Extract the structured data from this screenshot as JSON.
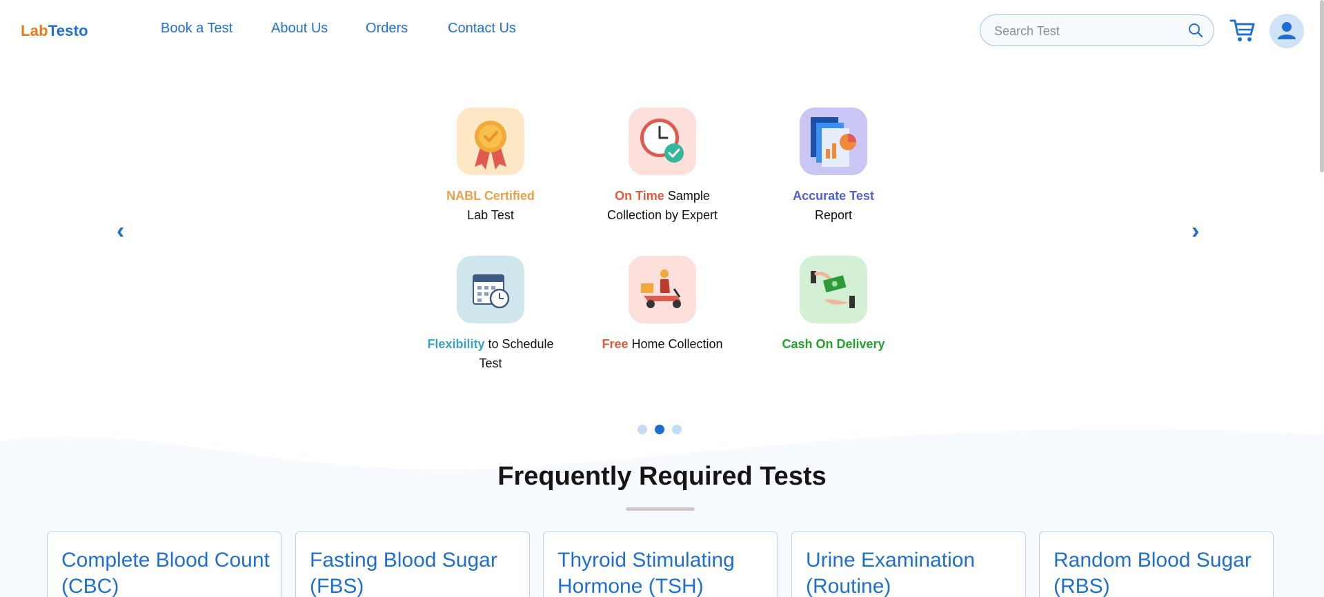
{
  "brand": {
    "part1": "Lab",
    "part2": "Testo",
    "color1": "#e8791c",
    "color2": "#1f6fd1"
  },
  "nav": [
    {
      "label": "Book a Test"
    },
    {
      "label": "About Us"
    },
    {
      "label": "Orders"
    },
    {
      "label": "Contact Us"
    }
  ],
  "search": {
    "placeholder": "Search Test",
    "icon": "search-icon"
  },
  "header_icons": {
    "cart": "cart-icon",
    "profile": "user-avatar-icon"
  },
  "carousel": {
    "prev": "‹",
    "next": "›",
    "features": [
      {
        "highlight": "NABL Certified",
        "rest": "Lab Test",
        "highlight_color": "#e8a04a",
        "icon": "award-medal-icon"
      },
      {
        "highlight": "On Time",
        "rest": " Sample Collection by Expert",
        "highlight_color": "#e05a3c",
        "icon": "clock-check-icon"
      },
      {
        "highlight": "Accurate Test",
        "rest": "Report",
        "highlight_color": "#4f5fd6",
        "icon": "report-chart-icon"
      },
      {
        "highlight": "Flexibility",
        "rest": " to Schedule Test",
        "highlight_color": "#3aa3c2",
        "icon": "calendar-clock-icon"
      },
      {
        "highlight": "Free",
        "rest": " Home Collection",
        "highlight_color": "#e05a3c",
        "icon": "delivery-scooter-icon"
      },
      {
        "highlight": "Cash On Delivery",
        "rest": "",
        "highlight_color": "#1fa32a",
        "icon": "cash-payment-icon"
      }
    ],
    "slide_count": 3,
    "active_slide": 2
  },
  "frequent": {
    "title": "Frequently Required Tests",
    "tests": [
      {
        "name": "Complete Blood Count (CBC)"
      },
      {
        "name": "Fasting Blood Sugar (FBS)"
      },
      {
        "name": "Thyroid Stimulating Hormone (TSH)"
      },
      {
        "name": "Urine Examination (Routine)"
      },
      {
        "name": "Random Blood Sugar (RBS)"
      }
    ]
  }
}
